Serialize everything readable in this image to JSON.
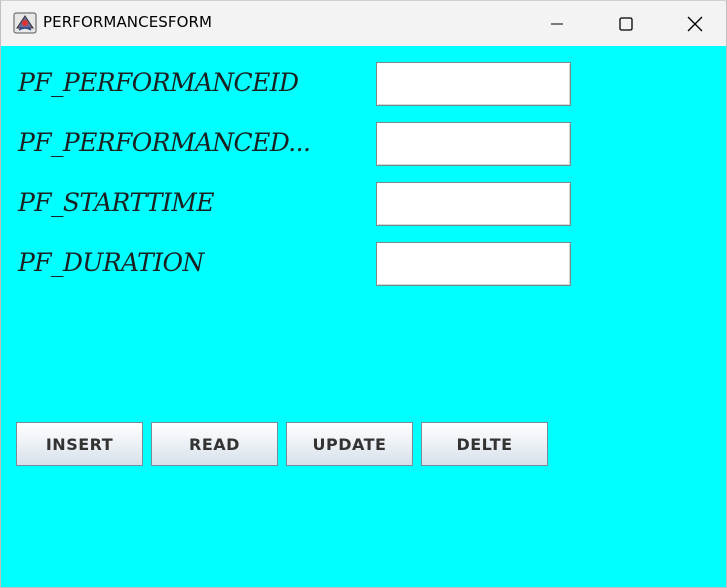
{
  "window": {
    "title": "PERFORMANCESFORM"
  },
  "form": {
    "fields": [
      {
        "label": "PF_PERFORMANCEID",
        "value": ""
      },
      {
        "label": "PF_PERFORMANCED...",
        "value": ""
      },
      {
        "label": "PF_STARTTIME",
        "value": ""
      },
      {
        "label": "PF_DURATION",
        "value": ""
      }
    ]
  },
  "buttons": {
    "insert": "INSERT",
    "read": "READ",
    "update": "UPDATE",
    "delete": "DELTE"
  },
  "colors": {
    "background": "#00ffff",
    "titlebar": "#f3f3f3"
  },
  "icons": {
    "app": "java-app-icon",
    "minimize": "minimize-icon",
    "maximize": "maximize-icon",
    "close": "close-icon"
  }
}
